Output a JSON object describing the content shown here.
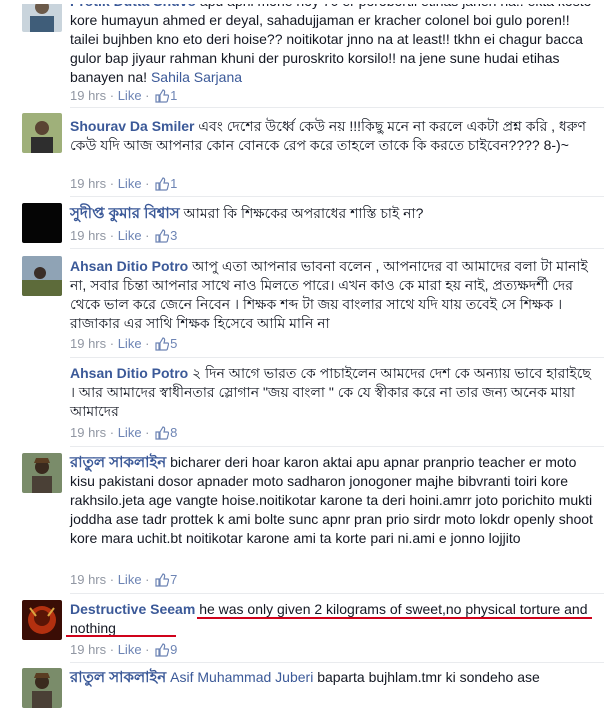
{
  "comments": [
    {
      "author": "Protik Dutta Shuvo",
      "text": "apu apni mone hoy 70 er porobortii etihas janen na.. ekta kosto kore humayun ahmed er deyal, sahadujjaman er kracher colonel boi gulo poren!! tailei bujhben kno eto deri hoise?? noitikotar jnno na at least!! tkhn ei chagur bacca gulor bap jiyaur rahman khuni der puroskrito korsilo!! na jene sune hudai etihas banayen na!",
      "tag": "Sahila Sarjana",
      "time": "19 hrs",
      "like": "Like",
      "likes": "1"
    },
    {
      "author": "Shourav Da Smiler",
      "text": "এবং দেশের উর্ধ্বে কেউ নয় !!!কিছু মনে না করলে একটা প্রশ্ন করি , ধরুণ কেউ যদি আজ আপনার কোন বোনকে রেপ করে তাহলে তাকে কি করতে চাইবেন???? 8-)~",
      "time": "19 hrs",
      "like": "Like",
      "likes": "1"
    },
    {
      "author": "সুদীপ্ত কুমার বিশ্বাস",
      "text": "আমরা কি শিক্ষকের অপরাধের শাস্তি চাই না?",
      "time": "19 hrs",
      "like": "Like",
      "likes": "3"
    },
    {
      "author": "Ahsan Ditio Potro",
      "text": "আপু এতা আপনার ভাবনা বলেন , আপনাদের বা আমাদের বলা টা মানাই না, সবার চিন্তা আপনার সাথে নাও মিলতে পারে। এখন কাও কে মারা হয় নাই, প্রত্যক্ষদর্শী দের থেকে ভাল করে জেনে নিবেন । শিক্ষক শব্দ টা জয় বাংলার সাথে যদি যায় তবেই সে শিক্ষক । রাজাকার এর সাথি শিক্ষক হিসেবে আমি মানি না",
      "time": "19 hrs",
      "like": "Like",
      "likes": "5"
    },
    {
      "author": "Ahsan Ditio Potro",
      "text": "২ দিন আগে ভারত কে পাচাইলেন আমদের দেশ কে অন্যায় ভাবে হারাইছে । আর আমাদের স্বাধীনতার স্লোগান \"জয় বাংলা \" কে যে স্বীকার করে না তার জন্য অনেক মায়া আমাদের",
      "time": "19 hrs",
      "like": "Like",
      "likes": "8"
    },
    {
      "author": "রাতুল সাকলাইন",
      "text": "bicharer deri hoar karon aktai apu apnar pranprio teacher er moto kisu pakistani dosor apnader moto sadharon jonogoner majhe bibvranti toiri kore rakhsilo.jeta age vangte hoise.noitikotar karone ta deri hoini.amrr joto porichito mukti joddha ase tadr prottek k ami bolte sunc apnr pran prio sirdr moto lokdr openly shoot kore mara uchit.bt noitikotar karone ami ta korte pari ni.ami e jonno lojjito",
      "time": "19 hrs",
      "like": "Like",
      "likes": "7"
    },
    {
      "author": "Destructive Seeam",
      "text": "he was only given 2 kilograms of sweet,no physical torture and nothing",
      "time": "19 hrs",
      "like": "Like",
      "likes": "9"
    },
    {
      "author": "রাতুল সাকলাইন",
      "tag": "Asif Muhammad Juberi",
      "text": "baparta bujhlam.tmr ki sondeho ase"
    }
  ],
  "colors": {
    "link": "#3b5998",
    "meta": "#9197a3",
    "highlight": "#d0021b"
  }
}
